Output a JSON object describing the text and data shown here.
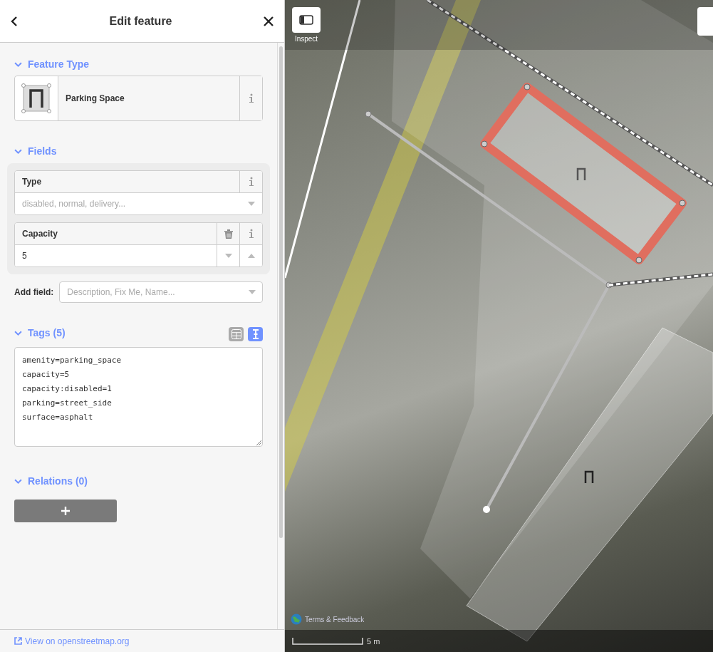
{
  "header": {
    "title": "Edit feature"
  },
  "feature_type": {
    "heading": "Feature Type",
    "expanded": true,
    "preset": "Parking Space"
  },
  "fields": {
    "heading": "Fields",
    "expanded": true,
    "items": [
      {
        "kind": "combo",
        "label": "Type",
        "placeholder": "disabled, normal, delivery...",
        "removable": false
      },
      {
        "kind": "number",
        "label": "Capacity",
        "value": "5",
        "removable": true
      }
    ]
  },
  "add_field": {
    "label": "Add field:",
    "placeholder": "Description, Fix Me, Name..."
  },
  "tags": {
    "heading": "Tags (5)",
    "expanded": true,
    "views": [
      {
        "kind": "list",
        "selected": false
      },
      {
        "kind": "text",
        "selected": true
      }
    ],
    "lines": [
      "amenity=parking_space",
      "capacity=5",
      "capacity:disabled=1",
      "parking=street_side",
      "surface=asphalt"
    ]
  },
  "relations": {
    "heading": "Relations (0)",
    "expanded": true
  },
  "footer": {
    "link": "View on openstreetmap.org"
  },
  "map": {
    "inspect_label": "Inspect",
    "attribution": "Terms & Feedback",
    "scale": "5 m"
  }
}
